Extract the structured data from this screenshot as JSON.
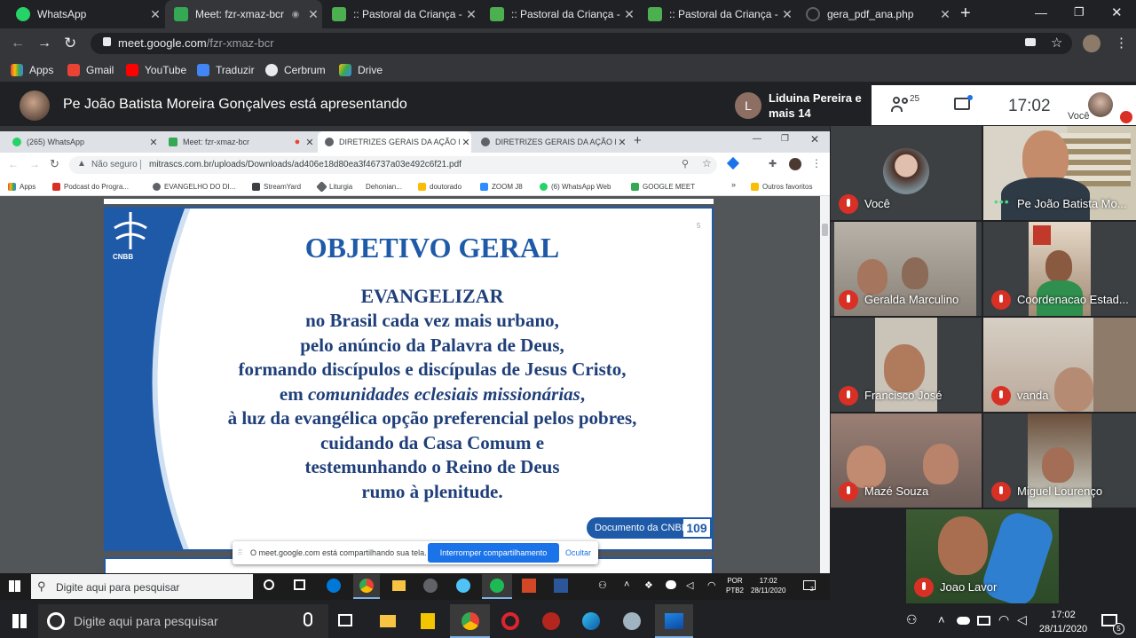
{
  "outer_tabs": [
    {
      "title": "WhatsApp",
      "color": "#25d366"
    },
    {
      "title": "Meet: fzr-xmaz-bcr",
      "color": "#34a853"
    },
    {
      "title": ":: Pastoral da Criança - S",
      "color": "#4caf50"
    },
    {
      "title": ":: Pastoral da Criança - S",
      "color": "#4caf50"
    },
    {
      "title": ":: Pastoral da Criança - S",
      "color": "#4caf50"
    },
    {
      "title": "gera_pdf_ana.php",
      "color": "#5f6368"
    }
  ],
  "address": {
    "host": "meet.google.com",
    "path": "/fzr-xmaz-bcr"
  },
  "bookmarks": [
    "Apps",
    "Gmail",
    "YouTube",
    "Traduzir",
    "Cerbrum",
    "Drive"
  ],
  "meet": {
    "presenting_text": "Pe João Batista Moreira Gonçalves está apresentando",
    "participants_text": "Liduina Pereira e mais 14",
    "participants_initial": "L",
    "participant_count": "25",
    "clock": "17:02",
    "self_label": "Você"
  },
  "inner_tabs": [
    {
      "title": "(265) WhatsApp"
    },
    {
      "title": "Meet: fzr-xmaz-bcr"
    },
    {
      "title": "DIRETRIZES GERAIS DA AÇÃO EV"
    },
    {
      "title": "DIRETRIZES GERAIS DA AÇÃO EV"
    }
  ],
  "inner_address": {
    "secure_label": "Não seguro",
    "url": "mitrascs.com.br/uploads/Downloads/ad406e18d80ea3f46737a03e492c6f21.pdf"
  },
  "inner_bookmarks": [
    "Apps",
    "Podcast do Progra...",
    "EVANGELHO DO DI...",
    "StreamYard",
    "Liturgia",
    "Dehonian...",
    "doutorado",
    "ZOOM J8",
    "(6) WhatsApp Web",
    "GOOGLE MEET",
    "Outros favoritos"
  ],
  "slide": {
    "logo_text": "CNBB",
    "page_number": "5",
    "title": "OBJETIVO GERAL",
    "lines": [
      "EVANGELIZAR",
      "no Brasil cada vez mais urbano,",
      "pelo anúncio da Palavra de Deus,",
      "formando discípulos e discípulas de Jesus Cristo,",
      "em comunidades eclesiais missionárias,",
      "à luz da evangélica opção preferencial pelos pobres,",
      "cuidando da Casa Comum e",
      "testemunhando o Reino de Deus",
      "rumo à plenitude."
    ],
    "doc_label": "Documento da CNBB",
    "doc_number": "109"
  },
  "share_bar": {
    "text": "O meet.google.com está compartilhando sua tela.",
    "stop_button": "Interromper compartilhamento",
    "hide_button": "Ocultar"
  },
  "inner_taskbar": {
    "search_placeholder": "Digite aqui para pesquisar",
    "lang1": "POR",
    "lang2": "PTB2",
    "time": "17:02",
    "date": "28/11/2020",
    "notif": "2"
  },
  "tiles": [
    {
      "name": "Você"
    },
    {
      "name": "Pe João Batista Mo..."
    },
    {
      "name": "Geralda Marculino"
    },
    {
      "name": "Coordenacao Estad..."
    },
    {
      "name": "Francisco José"
    },
    {
      "name": "vanda"
    },
    {
      "name": "Mazé Souza"
    },
    {
      "name": "Miguel Lourenço"
    },
    {
      "name": "Joao Lavor"
    }
  ],
  "outer_taskbar": {
    "search_placeholder": "Digite aqui para pesquisar",
    "time": "17:02",
    "date": "28/11/2020",
    "notif": "5"
  }
}
